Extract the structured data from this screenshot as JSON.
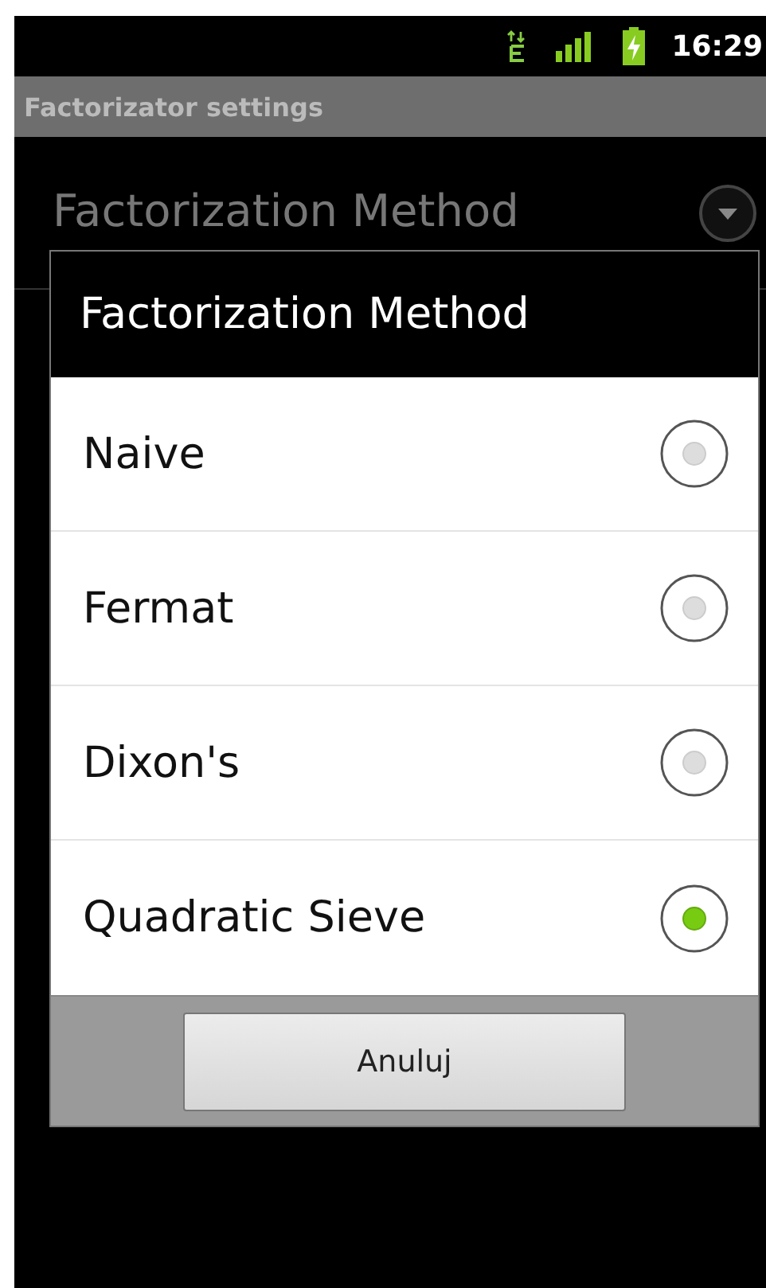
{
  "status_bar": {
    "time": "16:29"
  },
  "title_bar": {
    "title": "Factorizator settings"
  },
  "preference": {
    "title": "Factorization Method"
  },
  "dialog": {
    "title": "Factorization Method",
    "options": [
      {
        "label": "Naive",
        "selected": false
      },
      {
        "label": "Fermat",
        "selected": false
      },
      {
        "label": "Dixon's",
        "selected": false
      },
      {
        "label": "Quadratic Sieve",
        "selected": true
      }
    ],
    "buttons": [
      "Anuluj"
    ]
  }
}
